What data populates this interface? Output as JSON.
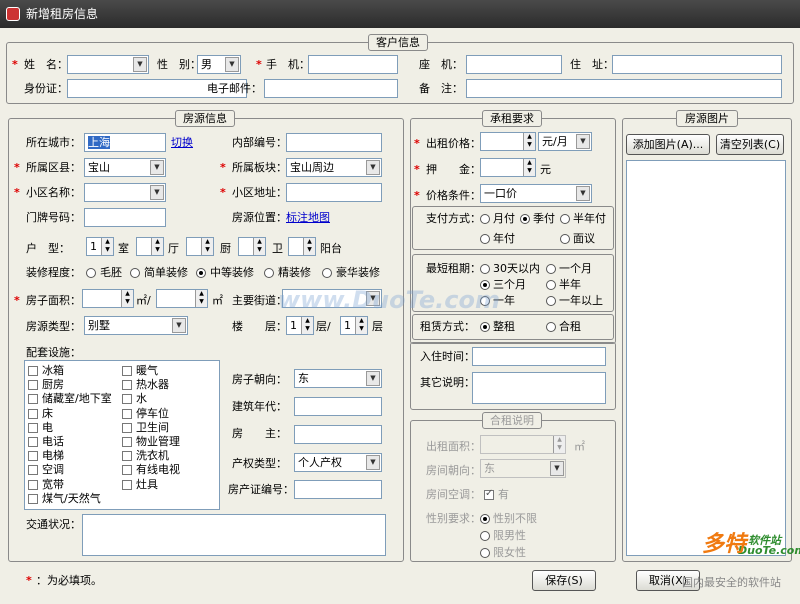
{
  "window": {
    "title": "新增租房信息"
  },
  "customer": {
    "title": "客户信息",
    "name_label": "姓　名：",
    "gender_label": "性　别：",
    "gender_value": "男",
    "mobile_label": "手　机：",
    "phone_label": "座　机：",
    "address_label": "住　址：",
    "id_label": "身份证：",
    "email_label": "电子邮件：",
    "note_label": "备　注："
  },
  "house": {
    "title": "房源信息",
    "city_label": "所在城市：",
    "city_value": "上海",
    "switch_link": "切换",
    "code_label": "内部编号：",
    "district_label": "所属区县：",
    "district_value": "宝山",
    "block_label": "所属板块：",
    "block_value": "宝山周边",
    "community_label": "小区名称：",
    "community_addr_label": "小区地址：",
    "door_label": "门牌号码：",
    "location_label": "房源位置：",
    "map_link": "标注地图",
    "layout_label": "户　型：",
    "room_value": "1",
    "room_unit": "室",
    "hall_unit": "厅",
    "kitchen_unit": "厨",
    "bath_unit": "卫",
    "balcony_unit": "阳台",
    "decor_label": "装修程度：",
    "decor_options": [
      "毛胚",
      "简单装修",
      "中等装修",
      "精装修",
      "豪华装修"
    ],
    "decor_selected": "中等装修",
    "area_label": "房子面积：",
    "area_unit1": "㎡/",
    "area_unit2": "㎡",
    "street_label": "主要街道：",
    "type_label": "房源类型：",
    "type_value": "别墅",
    "floor_label": "楼　　层：",
    "floor_value": "1",
    "floor_unit": "层/",
    "floor_total": "1",
    "floor_total_unit": "层",
    "facilities_label": "配套设施：",
    "facilities_col1": [
      "冰箱",
      "厨房",
      "储藏室/地下室",
      "床",
      "电",
      "电话",
      "电梯",
      "空调",
      "宽带",
      "煤气/天然气"
    ],
    "facilities_col2": [
      "暖气",
      "热水器",
      "水",
      "停车位",
      "卫生间",
      "物业管理",
      "洗衣机",
      "有线电视",
      "灶具"
    ],
    "orient_label": "房子朝向：",
    "orient_value": "东",
    "year_label": "建筑年代：",
    "owner_label": "房　　主：",
    "property_label": "产权类型：",
    "property_value": "个人产权",
    "cert_label": "房产证编号：",
    "traffic_label": "交通状况："
  },
  "rent": {
    "title": "承租要求",
    "price_label": "出租价格：",
    "price_unit": "元/月",
    "deposit_label": "押　　金：",
    "deposit_unit": "元",
    "price_cond_label": "价格条件：",
    "price_cond_value": "一口价",
    "pay_label": "支付方式：",
    "pay_options": [
      "月付",
      "季付",
      "半年付",
      "年付",
      "面议"
    ],
    "pay_selected": "季付",
    "min_label": "最短租期：",
    "min_options": [
      "30天以内",
      "一个月",
      "三个月",
      "半年",
      "一年",
      "一年以上"
    ],
    "min_selected": "三个月",
    "mode_label": "租赁方式：",
    "mode_options": [
      "整租",
      "合租"
    ],
    "mode_selected": "整租",
    "checkin_label": "入住时间：",
    "other_label": "其它说明："
  },
  "share": {
    "title": "合租说明",
    "area_label": "出租面积：",
    "area_unit": "㎡",
    "orient_label": "房间朝向：",
    "orient_value": "东",
    "ac_label": "房间空调：",
    "ac_value": "有",
    "gender_label": "性别要求：",
    "gender_options": [
      "性别不限",
      "限男性",
      "限女性"
    ],
    "gender_selected": "性别不限"
  },
  "photos": {
    "title": "房源图片",
    "add_button": "添加图片(A)...",
    "clear_button": "清空列表(C)"
  },
  "footer": {
    "required_note": "：为必填项。",
    "save_button": "保存(S)",
    "cancel_button": "取消(X)"
  },
  "watermarks": {
    "site1": "www.DuoTe.com",
    "site2": "DuoTe.com",
    "brand": "多特",
    "brand_sub": "软件站",
    "slogan": "国内最安全的软件站"
  }
}
